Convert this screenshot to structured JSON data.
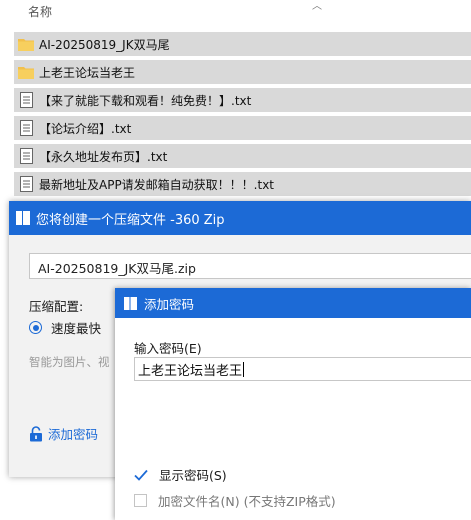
{
  "file_list": {
    "column_name": "名称",
    "items": [
      {
        "name": "AI-20250819_JK双马尾",
        "icon": "folder-icon"
      },
      {
        "name": "上老王论坛当老王",
        "icon": "folder-icon"
      },
      {
        "name": "【来了就能下载和观看！纯免费！】.txt",
        "icon": "text-file-icon"
      },
      {
        "name": "【论坛介绍】.txt",
        "icon": "text-file-icon"
      },
      {
        "name": "【永久地址发布页】.txt",
        "icon": "text-file-icon"
      },
      {
        "name": "最新地址及APP请发邮箱自动获取！！！.txt",
        "icon": "text-file-icon"
      }
    ]
  },
  "zip_dialog": {
    "title": "您将创建一个压缩文件 -360 Zip",
    "filename": "AI-20250819_JK双马尾.zip",
    "config_label": "压缩配置:",
    "selected_option": "速度最快",
    "smart_text": "智能为图片、视",
    "add_password_link": "添加密码"
  },
  "password_dialog": {
    "title": "添加密码",
    "input_label": "输入密码(E)",
    "password_value": "上老王论坛当老王",
    "show_password_label": "显示密码(S)",
    "show_password_checked": true,
    "encrypt_filename_label": "加密文件名(N) (不支持ZIP格式)",
    "encrypt_filename_checked": false
  },
  "colors": {
    "accent": "#1c6ad6",
    "folder": "#f2c04c",
    "row_highlight": "#d9d9d9"
  }
}
